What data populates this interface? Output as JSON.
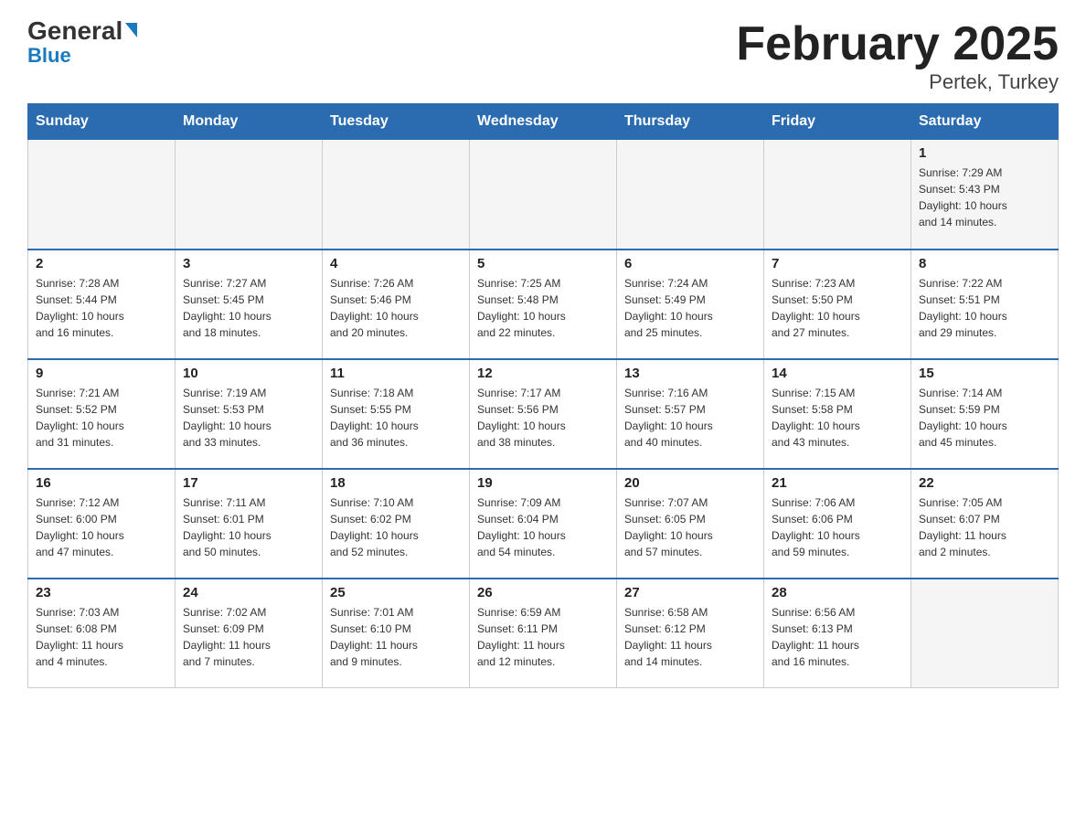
{
  "header": {
    "logo_line1": "General",
    "logo_line2": "Blue",
    "title": "February 2025",
    "subtitle": "Pertek, Turkey"
  },
  "days_of_week": [
    "Sunday",
    "Monday",
    "Tuesday",
    "Wednesday",
    "Thursday",
    "Friday",
    "Saturday"
  ],
  "weeks": [
    [
      {
        "day": "",
        "info": ""
      },
      {
        "day": "",
        "info": ""
      },
      {
        "day": "",
        "info": ""
      },
      {
        "day": "",
        "info": ""
      },
      {
        "day": "",
        "info": ""
      },
      {
        "day": "",
        "info": ""
      },
      {
        "day": "1",
        "info": "Sunrise: 7:29 AM\nSunset: 5:43 PM\nDaylight: 10 hours\nand 14 minutes."
      }
    ],
    [
      {
        "day": "2",
        "info": "Sunrise: 7:28 AM\nSunset: 5:44 PM\nDaylight: 10 hours\nand 16 minutes."
      },
      {
        "day": "3",
        "info": "Sunrise: 7:27 AM\nSunset: 5:45 PM\nDaylight: 10 hours\nand 18 minutes."
      },
      {
        "day": "4",
        "info": "Sunrise: 7:26 AM\nSunset: 5:46 PM\nDaylight: 10 hours\nand 20 minutes."
      },
      {
        "day": "5",
        "info": "Sunrise: 7:25 AM\nSunset: 5:48 PM\nDaylight: 10 hours\nand 22 minutes."
      },
      {
        "day": "6",
        "info": "Sunrise: 7:24 AM\nSunset: 5:49 PM\nDaylight: 10 hours\nand 25 minutes."
      },
      {
        "day": "7",
        "info": "Sunrise: 7:23 AM\nSunset: 5:50 PM\nDaylight: 10 hours\nand 27 minutes."
      },
      {
        "day": "8",
        "info": "Sunrise: 7:22 AM\nSunset: 5:51 PM\nDaylight: 10 hours\nand 29 minutes."
      }
    ],
    [
      {
        "day": "9",
        "info": "Sunrise: 7:21 AM\nSunset: 5:52 PM\nDaylight: 10 hours\nand 31 minutes."
      },
      {
        "day": "10",
        "info": "Sunrise: 7:19 AM\nSunset: 5:53 PM\nDaylight: 10 hours\nand 33 minutes."
      },
      {
        "day": "11",
        "info": "Sunrise: 7:18 AM\nSunset: 5:55 PM\nDaylight: 10 hours\nand 36 minutes."
      },
      {
        "day": "12",
        "info": "Sunrise: 7:17 AM\nSunset: 5:56 PM\nDaylight: 10 hours\nand 38 minutes."
      },
      {
        "day": "13",
        "info": "Sunrise: 7:16 AM\nSunset: 5:57 PM\nDaylight: 10 hours\nand 40 minutes."
      },
      {
        "day": "14",
        "info": "Sunrise: 7:15 AM\nSunset: 5:58 PM\nDaylight: 10 hours\nand 43 minutes."
      },
      {
        "day": "15",
        "info": "Sunrise: 7:14 AM\nSunset: 5:59 PM\nDaylight: 10 hours\nand 45 minutes."
      }
    ],
    [
      {
        "day": "16",
        "info": "Sunrise: 7:12 AM\nSunset: 6:00 PM\nDaylight: 10 hours\nand 47 minutes."
      },
      {
        "day": "17",
        "info": "Sunrise: 7:11 AM\nSunset: 6:01 PM\nDaylight: 10 hours\nand 50 minutes."
      },
      {
        "day": "18",
        "info": "Sunrise: 7:10 AM\nSunset: 6:02 PM\nDaylight: 10 hours\nand 52 minutes."
      },
      {
        "day": "19",
        "info": "Sunrise: 7:09 AM\nSunset: 6:04 PM\nDaylight: 10 hours\nand 54 minutes."
      },
      {
        "day": "20",
        "info": "Sunrise: 7:07 AM\nSunset: 6:05 PM\nDaylight: 10 hours\nand 57 minutes."
      },
      {
        "day": "21",
        "info": "Sunrise: 7:06 AM\nSunset: 6:06 PM\nDaylight: 10 hours\nand 59 minutes."
      },
      {
        "day": "22",
        "info": "Sunrise: 7:05 AM\nSunset: 6:07 PM\nDaylight: 11 hours\nand 2 minutes."
      }
    ],
    [
      {
        "day": "23",
        "info": "Sunrise: 7:03 AM\nSunset: 6:08 PM\nDaylight: 11 hours\nand 4 minutes."
      },
      {
        "day": "24",
        "info": "Sunrise: 7:02 AM\nSunset: 6:09 PM\nDaylight: 11 hours\nand 7 minutes."
      },
      {
        "day": "25",
        "info": "Sunrise: 7:01 AM\nSunset: 6:10 PM\nDaylight: 11 hours\nand 9 minutes."
      },
      {
        "day": "26",
        "info": "Sunrise: 6:59 AM\nSunset: 6:11 PM\nDaylight: 11 hours\nand 12 minutes."
      },
      {
        "day": "27",
        "info": "Sunrise: 6:58 AM\nSunset: 6:12 PM\nDaylight: 11 hours\nand 14 minutes."
      },
      {
        "day": "28",
        "info": "Sunrise: 6:56 AM\nSunset: 6:13 PM\nDaylight: 11 hours\nand 16 minutes."
      },
      {
        "day": "",
        "info": ""
      }
    ]
  ]
}
